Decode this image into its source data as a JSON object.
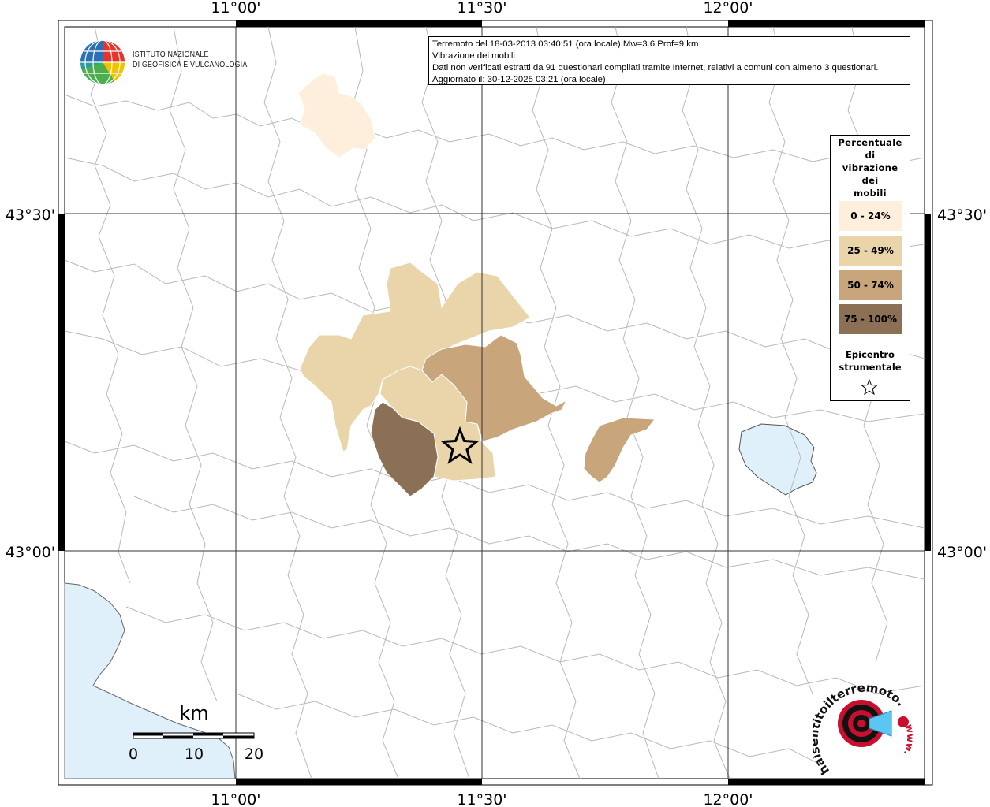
{
  "header": {
    "line1": "Terremoto del 18-03-2013 03:40:51 (ora locale) Mw=3.6 Prof=9 km",
    "line2": "Vibrazione dei mobili",
    "line3": "Dati non verificati estratti da 91 questionari compilati tramite Internet, relativi a comuni con almeno 3 questionari.",
    "line4": "Aggiornato il: 30-12-2025 03:21 (ora locale)"
  },
  "axes": {
    "lon_ticks": [
      "11°00'",
      "11°30'",
      "12°00'"
    ],
    "lat_ticks": [
      "43°30'",
      "43°00'"
    ]
  },
  "legend": {
    "title_lines": [
      "Percentuale",
      "di",
      "vibrazione",
      "dei",
      "mobili"
    ],
    "classes": [
      {
        "label": "0 - 24%",
        "color": "#fdefdc"
      },
      {
        "label": "25 - 49%",
        "color": "#ead5ab"
      },
      {
        "label": "50 - 74%",
        "color": "#c8a57a"
      },
      {
        "label": "75 - 100%",
        "color": "#8b7055"
      }
    ],
    "epicenter_lines": [
      "Epicentro",
      "strumentale"
    ],
    "epicenter_icon": "star-outline-icon"
  },
  "scale_bar": {
    "unit": "km",
    "ticks": [
      "0",
      "10",
      "20"
    ]
  },
  "logos": {
    "ingv_lines": [
      "ISTITUTO NAZIONALE",
      "DI GEOFISICA E VULCANOLOGIA"
    ],
    "haisentito_arc": "haisentitoilterremoto.it",
    "haisentito_www": "www."
  },
  "colors": {
    "sea": "#dff0fb",
    "boundaries": "#b8b8b8"
  }
}
